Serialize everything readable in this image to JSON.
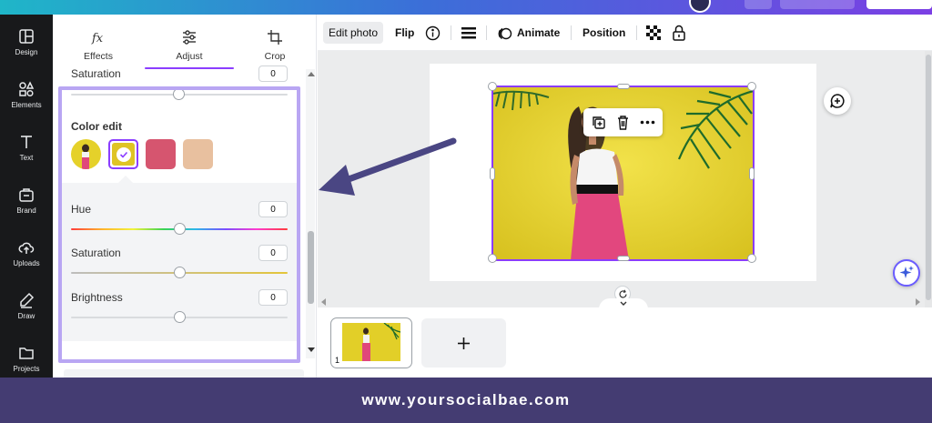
{
  "nav": {
    "items": [
      {
        "label": "Design",
        "icon": "layout-icon"
      },
      {
        "label": "Elements",
        "icon": "shapes-icon"
      },
      {
        "label": "Text",
        "icon": "text-icon"
      },
      {
        "label": "Brand",
        "icon": "brand-icon"
      },
      {
        "label": "Uploads",
        "icon": "cloud-upload-icon"
      },
      {
        "label": "Draw",
        "icon": "pen-icon"
      },
      {
        "label": "Projects",
        "icon": "folder-icon"
      }
    ]
  },
  "panel": {
    "tabs": [
      {
        "label": "Effects",
        "icon": "fx-icon"
      },
      {
        "label": "Adjust",
        "icon": "sliders-icon",
        "active": true
      },
      {
        "label": "Crop",
        "icon": "crop-icon"
      }
    ],
    "top_saturation": {
      "label": "Saturation",
      "value": "0"
    },
    "color_edit_title": "Color edit",
    "sliders": [
      {
        "label": "Hue",
        "value": "0",
        "position": 0.5
      },
      {
        "label": "Saturation",
        "value": "0",
        "position": 0.5
      },
      {
        "label": "Brightness",
        "value": "0",
        "position": 0.5
      }
    ],
    "swatches": [
      "#d6556f",
      "#e8c09f"
    ]
  },
  "toolbar": {
    "edit_photo": "Edit photo",
    "flip": "Flip",
    "animate": "Animate",
    "position": "Position"
  },
  "pages": {
    "thumb_number": "1"
  },
  "footer": {
    "text": "www.yoursocialbae.com"
  },
  "colors": {
    "accent": "#8b3dff",
    "highlight": "#b9a6f3",
    "arrow": "#4a4683",
    "footer_bg": "#443c72"
  }
}
